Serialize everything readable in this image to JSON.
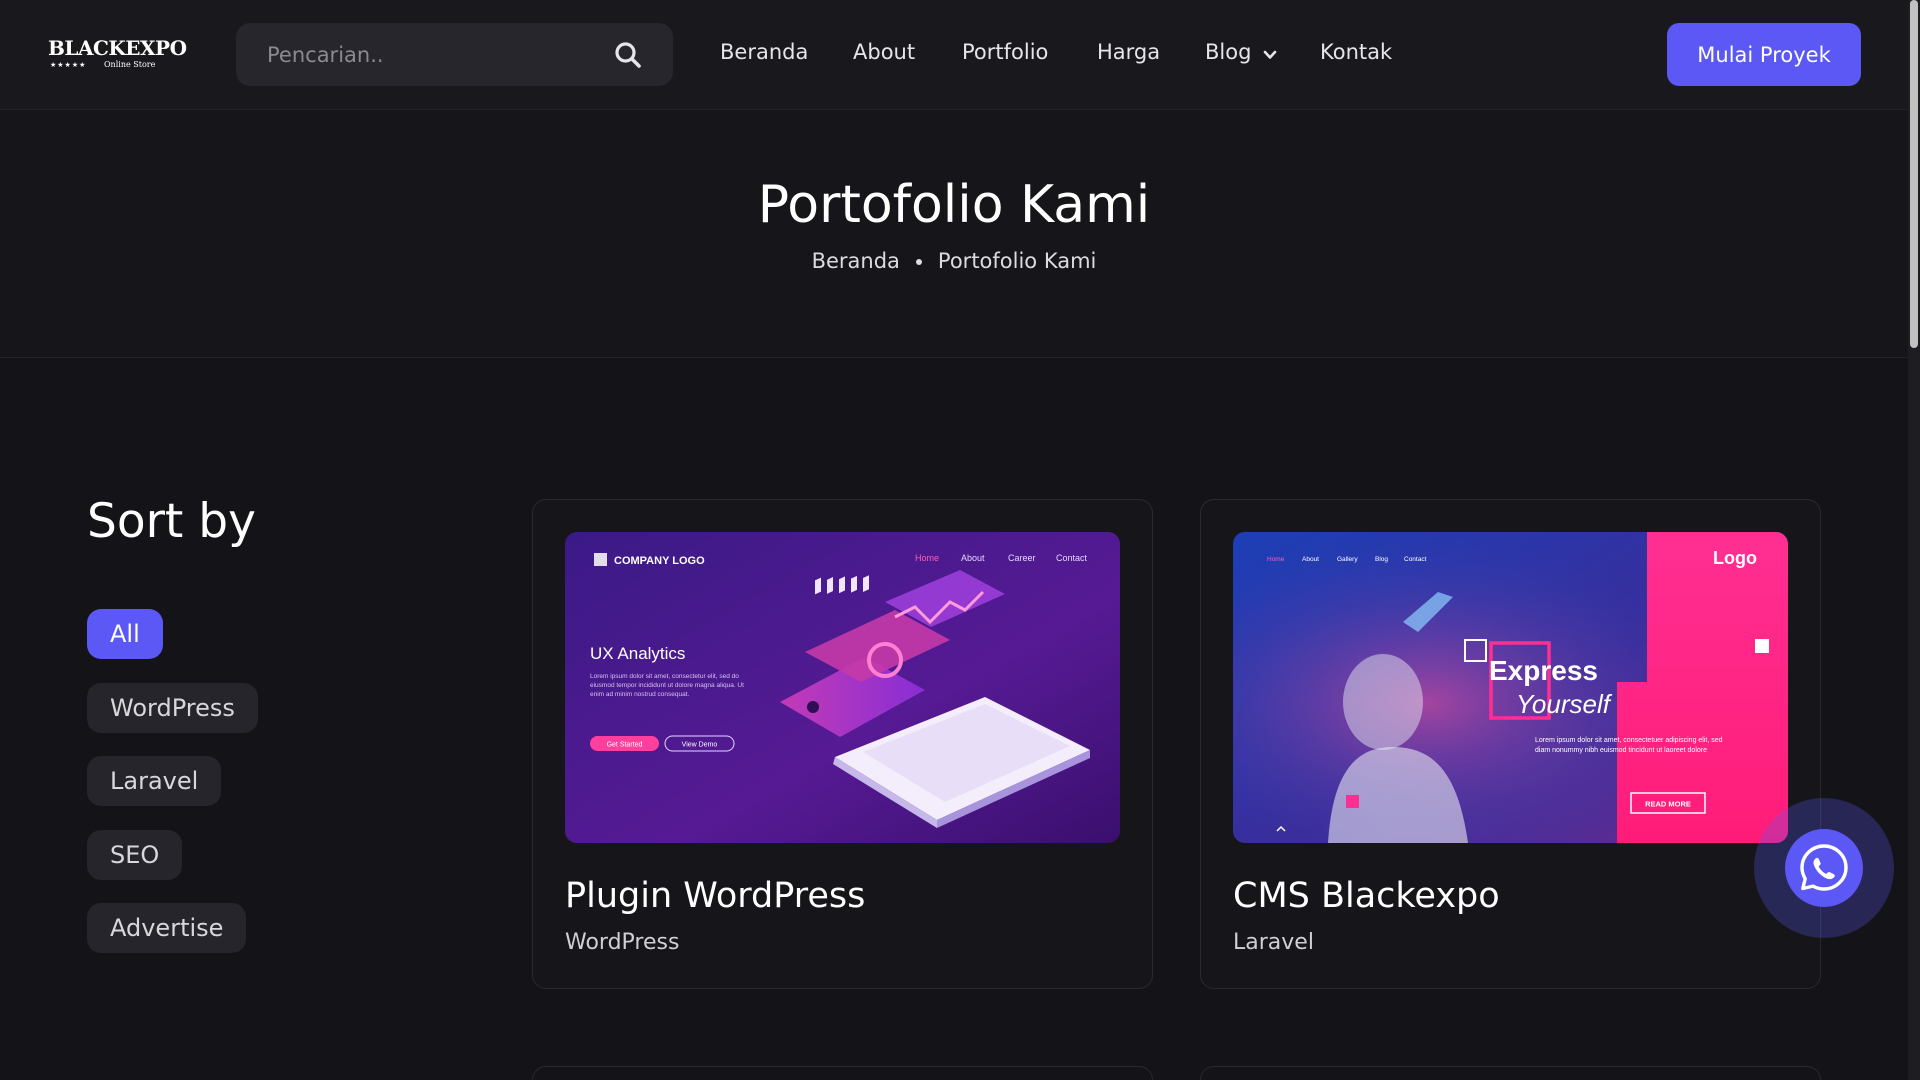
{
  "logo": {
    "brand": "BLACKEXPO",
    "stars": "★★★★★",
    "subtitle": "Online Store"
  },
  "search": {
    "placeholder": "Pencarian.."
  },
  "nav": [
    {
      "label": "Beranda"
    },
    {
      "label": "About"
    },
    {
      "label": "Portfolio"
    },
    {
      "label": "Harga"
    },
    {
      "label": "Blog",
      "has_dropdown": true
    },
    {
      "label": "Kontak"
    }
  ],
  "cta": {
    "label": "Mulai Proyek"
  },
  "hero": {
    "title": "Portofolio Kami",
    "breadcrumb": [
      "Beranda",
      "Portofolio Kami"
    ]
  },
  "sort": {
    "title": "Sort by",
    "filters": [
      "All",
      "WordPress",
      "Laravel",
      "SEO",
      "Advertise"
    ],
    "active": "All"
  },
  "cards": [
    {
      "title": "Plugin WordPress",
      "category": "WordPress",
      "thumb": {
        "logo": "COMPANY LOGO",
        "menu": [
          "Home",
          "About",
          "Career",
          "Contact"
        ],
        "heading": "UX Analytics",
        "body": "Lorem ipsum dolor sit amet, consectetur elit, sed do eiusmod tempor incididunt ut dolore magna aliqua. Ut enim ad minim nostrud consequat.",
        "btn1": "Get Started",
        "btn2": "View Demo"
      }
    },
    {
      "title": "CMS Blackexpo",
      "category": "Laravel",
      "thumb": {
        "menu": [
          "Home",
          "About",
          "Gallery",
          "Blog",
          "Contact"
        ],
        "logo": "Logo",
        "heading1": "Express",
        "heading2": "Yourself",
        "body": "Lorem ipsum dolor sit amet, consectetuer adipiscing elit, sed diam nonummy nibh euismod tincidunt ut laoreet dolore",
        "btn": "READ MORE"
      }
    }
  ],
  "colors": {
    "accent": "#5b58f6",
    "background": "#141318",
    "surface": "#26252b"
  },
  "icons": {
    "search": "search-icon",
    "chevron": "chevron-down-icon",
    "whatsapp": "whatsapp-icon"
  }
}
